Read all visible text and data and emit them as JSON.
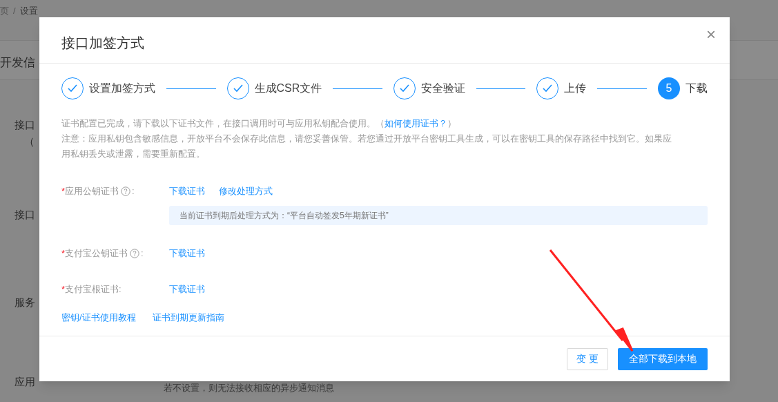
{
  "background": {
    "breadcrumb": [
      "页",
      "/",
      "设置"
    ],
    "section_title": "开发信",
    "labels": [
      "接口",
      "（",
      "接口",
      "服务",
      "应用"
    ],
    "hint": "若不设置，则无法接收相应的异步通知消息"
  },
  "dialog": {
    "title": "接口加签方式",
    "close": "×",
    "steps": [
      {
        "label": "设置加签方式",
        "completed": true
      },
      {
        "label": "生成CSR文件",
        "completed": true
      },
      {
        "label": "安全验证",
        "completed": true
      },
      {
        "label": "上传",
        "completed": true
      },
      {
        "label": "下载",
        "completed": false,
        "number": "5"
      }
    ],
    "notice": {
      "text": "证书配置已完成，请下载以下证书文件，在接口调用时可与应用私钥配合使用。（",
      "link": "如何使用证书？",
      "after": "）",
      "warning": "注意：应用私钥包含敏感信息，开放平台不会保存此信息，请您妥善保管。若您通过开放平台密钥工具生成，可以在密钥工具的保存路径中找到它。如果应用私钥丢失或泄露，需要重新配置。"
    },
    "fields": [
      {
        "required_mark": "*",
        "label": "应用公钥证书",
        "help": true,
        "suffix": ":",
        "links": [
          "下载证书",
          "修改处理方式"
        ],
        "info": "当前证书到期后处理方式为：“平台自动签发5年期新证书”"
      },
      {
        "required_mark": "*",
        "label": "支付宝公钥证书",
        "help": true,
        "suffix": ":",
        "links": [
          "下载证书"
        ]
      },
      {
        "required_mark": "*",
        "label": "支付宝根证书:",
        "help": false,
        "links": [
          "下载证书"
        ]
      }
    ],
    "guide_links": [
      "密钥/证书使用教程",
      "证书到期更新指南"
    ],
    "buttons": [
      {
        "label": "变 更",
        "kind": "default"
      },
      {
        "label": "全部下载到本地",
        "kind": "primary"
      }
    ]
  }
}
